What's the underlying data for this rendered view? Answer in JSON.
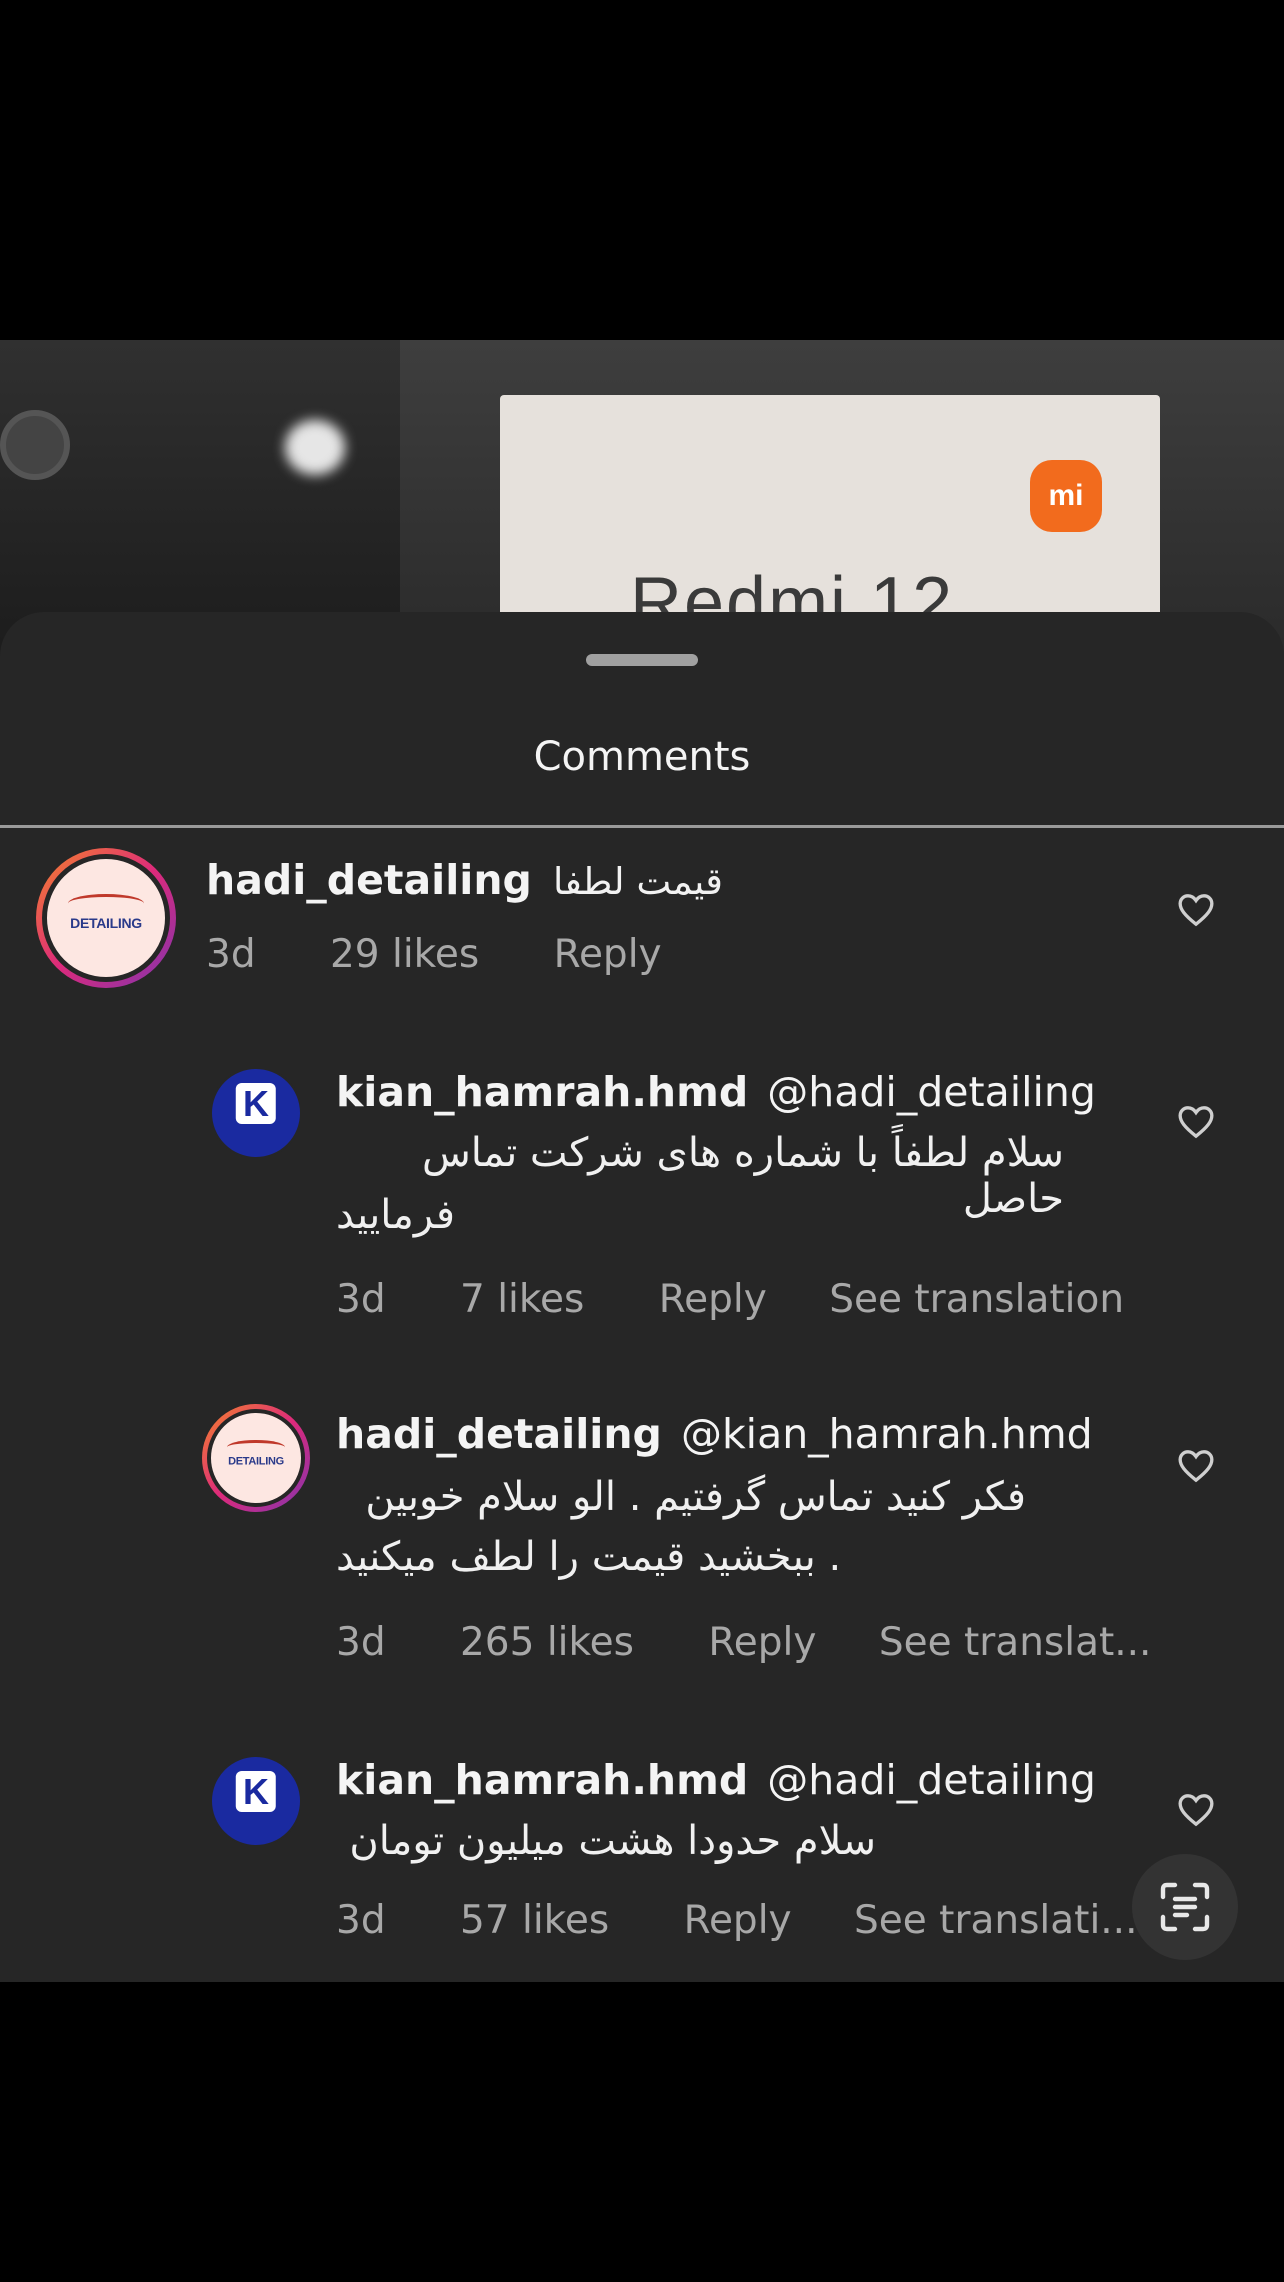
{
  "video": {
    "brand_text": "Redmi 12",
    "logo_text": "mi"
  },
  "sheet": {
    "title": "Comments"
  },
  "comments": [
    {
      "username": "hadi_detailing",
      "mention": "",
      "text": "قیمت لطفا",
      "time": "3d",
      "likes": "29 likes",
      "reply": "Reply",
      "translation": "",
      "avatar_label": "DETAILING"
    },
    {
      "username": "kian_hamrah.hmd",
      "mention": "@hadi_detailing",
      "text_line1": "سلام لطفاً با شماره های شرکت تماس حاصل",
      "text_line2": "فرمایید",
      "time": "3d",
      "likes": "7 likes",
      "reply": "Reply",
      "translation": "See translation",
      "avatar_label": "K"
    },
    {
      "username": "hadi_detailing",
      "mention": "@kian_hamrah.hmd",
      "text_line1": "فکر کنید تماس گرفتیم .  الو سلام خوبین",
      "text_line2": ". ببخشید قیمت را لطف میکنید",
      "time": "3d",
      "likes": "265 likes",
      "reply": "Reply",
      "translation": "See translat...",
      "avatar_label": "DETAILING"
    },
    {
      "username": "kian_hamrah.hmd",
      "mention": "@hadi_detailing",
      "text_line1": "سلام حدودا هشت میلیون تومان",
      "time": "3d",
      "likes": "57 likes",
      "reply": "Reply",
      "translation": "See translati...",
      "avatar_label": "K"
    }
  ],
  "icons": {
    "like": "heart-icon",
    "translate": "text-scan-icon"
  },
  "colors": {
    "sheet_bg": "#262626",
    "muted_text": "#a8a8a8",
    "story_ring": "#dd2a7b",
    "k_brand": "#1a2aa0"
  }
}
